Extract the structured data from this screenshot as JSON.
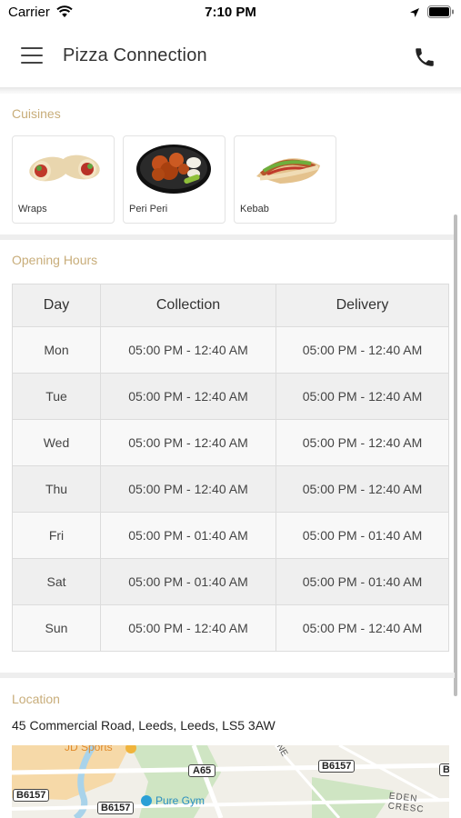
{
  "status_bar": {
    "carrier": "Carrier",
    "time": "7:10 PM"
  },
  "nav": {
    "title": "Pizza Connection"
  },
  "cuisines": {
    "heading": "Cuisines",
    "items": [
      {
        "label": "Wraps"
      },
      {
        "label": "Peri Peri"
      },
      {
        "label": "Kebab"
      }
    ]
  },
  "opening_hours": {
    "heading": "Opening Hours",
    "columns": [
      "Day",
      "Collection",
      "Delivery"
    ],
    "rows": [
      {
        "day": "Mon",
        "collection": "05:00 PM - 12:40 AM",
        "delivery": "05:00 PM - 12:40 AM"
      },
      {
        "day": "Tue",
        "collection": "05:00 PM - 12:40 AM",
        "delivery": "05:00 PM - 12:40 AM"
      },
      {
        "day": "Wed",
        "collection": "05:00 PM - 12:40 AM",
        "delivery": "05:00 PM - 12:40 AM"
      },
      {
        "day": "Thu",
        "collection": "05:00 PM - 12:40 AM",
        "delivery": "05:00 PM - 12:40 AM"
      },
      {
        "day": "Fri",
        "collection": "05:00 PM - 01:40 AM",
        "delivery": "05:00 PM - 01:40 AM"
      },
      {
        "day": "Sat",
        "collection": "05:00 PM - 01:40 AM",
        "delivery": "05:00 PM - 01:40 AM"
      },
      {
        "day": "Sun",
        "collection": "05:00 PM - 12:40 AM",
        "delivery": "05:00 PM - 12:40 AM"
      }
    ]
  },
  "location": {
    "heading": "Location",
    "address": "45 Commercial Road, Leeds, Leeds, LS5 3AW",
    "map_labels": {
      "jd_sports": "JD Sports",
      "pure_gym": "Pure Gym",
      "a65": "A65",
      "b6157_a": "B6157",
      "b6157_b": "B6157",
      "b6157_c": "B6157",
      "b_edge": "B",
      "eden": "EDEN CRESC",
      "ne": "NE"
    }
  },
  "colors": {
    "accent": "#c8ad7a",
    "map_green": "#cfe5c3",
    "map_water": "#a9d3ea",
    "map_orange": "#f6d9a8"
  }
}
